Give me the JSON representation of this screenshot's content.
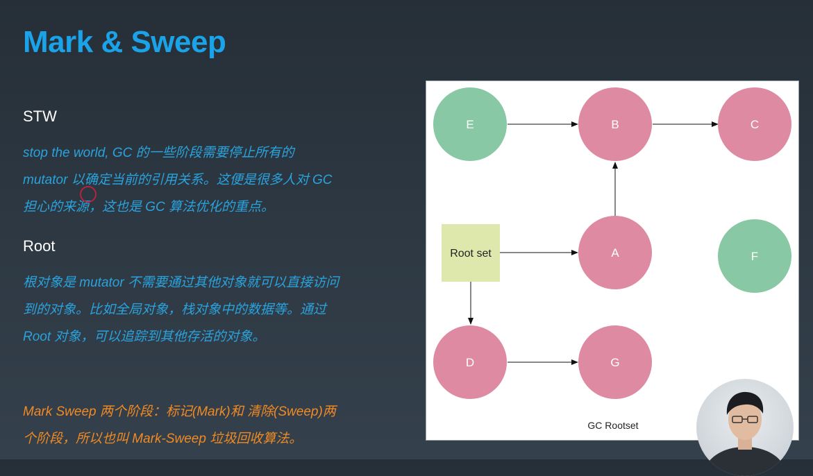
{
  "slide": {
    "title": "Mark & Sweep",
    "stw_heading": "STW",
    "stw_lines": [
      "stop the world, GC 的一些阶段需要停止所有的",
      "mutator 以确定当前的引用关系。这便是很多人对 GC",
      "担心的来源，这也是 GC 算法优化的重点。"
    ],
    "root_heading": "Root",
    "root_lines": [
      "根对象是 mutator 不需要通过其他对象就可以直接访问",
      "到的对象。比如全局对象，栈对象中的数据等。通过",
      "Root 对象，可以追踪到其他存活的对象。"
    ],
    "summary_lines": [
      "Mark Sweep 两个阶段：标记(Mark)和 清除(Sweep)两",
      "个阶段，所以也叫 Mark-Sweep 垃圾回收算法。"
    ]
  },
  "diagram": {
    "root_label": "Root set",
    "caption": "GC Rootset",
    "nodes": {
      "E": {
        "label": "E",
        "state": "unreachable"
      },
      "B": {
        "label": "B",
        "state": "reachable"
      },
      "C": {
        "label": "C",
        "state": "reachable"
      },
      "A": {
        "label": "A",
        "state": "reachable"
      },
      "F": {
        "label": "F",
        "state": "unreachable"
      },
      "D": {
        "label": "D",
        "state": "reachable"
      },
      "G": {
        "label": "G",
        "state": "reachable"
      }
    },
    "edges": [
      [
        "E",
        "B"
      ],
      [
        "B",
        "C"
      ],
      [
        "A",
        "B"
      ],
      [
        "Root set",
        "A"
      ],
      [
        "Root set",
        "D"
      ],
      [
        "D",
        "G"
      ]
    ],
    "colors": {
      "reachable": "#de8aa2",
      "unreachable": "#88c8a4",
      "root": "#dfe8ac"
    }
  }
}
